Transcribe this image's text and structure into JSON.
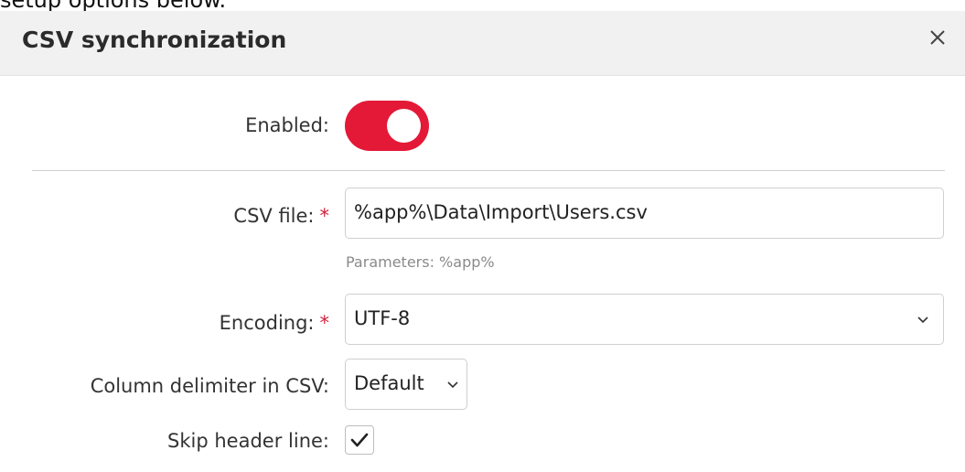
{
  "intro_text": "setup options below.",
  "dialog": {
    "title": "CSV synchronization",
    "close_icon": "close-icon"
  },
  "form": {
    "enabled": {
      "label": "Enabled:",
      "value": true
    },
    "csv_file": {
      "label": "CSV file:",
      "required_mark": "*",
      "value": "%app%\\Data\\Import\\Users.csv",
      "hint": "Parameters: %app%"
    },
    "encoding": {
      "label": "Encoding:",
      "required_mark": "*",
      "value": "UTF-8",
      "icon": "chevron-down-icon"
    },
    "column_delimiter": {
      "label": "Column delimiter in CSV:",
      "value": "Default",
      "icon": "chevron-down-icon"
    },
    "skip_header": {
      "label": "Skip header line:",
      "checked": true,
      "icon": "checkmark-icon"
    }
  },
  "colors": {
    "accent": "#e31937",
    "required": "#d21f3a",
    "header_bg": "#f1f1f1"
  }
}
